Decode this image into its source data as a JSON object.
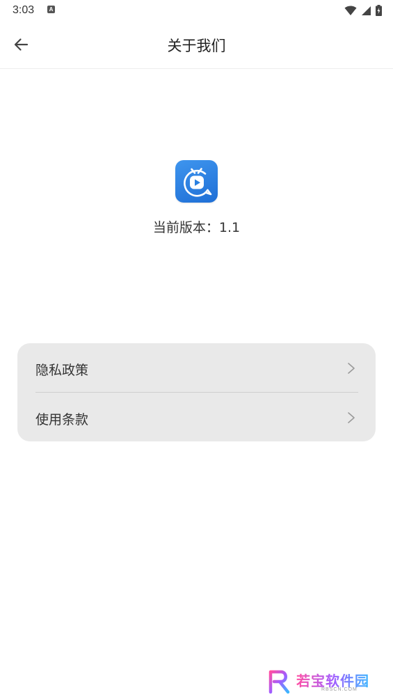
{
  "status_bar": {
    "time": "3:03",
    "notification_icon_letter": "A",
    "icons": [
      "wifi-icon",
      "signal-icon",
      "battery-icon"
    ]
  },
  "app_bar": {
    "title": "关于我们",
    "back_icon": "arrow-left-icon"
  },
  "app_info": {
    "logo_icon": "tv-play-icon",
    "logo_color": "#2a80e0",
    "version_text": "当前版本：1.1"
  },
  "menu": {
    "items": [
      {
        "label": "隐私政策",
        "icon": "chevron-right-icon"
      },
      {
        "label": "使用条款",
        "icon": "chevron-right-icon"
      }
    ]
  },
  "watermark": {
    "text": "若宝软件园",
    "subtext": "RBSCN.COM"
  }
}
